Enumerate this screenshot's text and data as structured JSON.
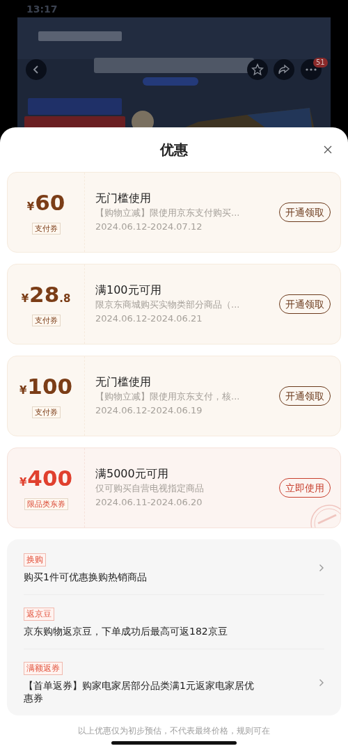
{
  "status_bar": {
    "time": "13:17"
  },
  "backdrop": {
    "kind": "picture",
    "badge": "51"
  },
  "sheet": {
    "title": "优惠"
  },
  "coupons": [
    {
      "kind": "pay",
      "currency": "¥",
      "amount": "60",
      "tag": "支付券",
      "title": "无门槛使用",
      "description": "【购物立减】限使用京东支付购买...",
      "dates": "2024.06.12-2024.07.12",
      "action": "开通领取",
      "claimed": false
    },
    {
      "kind": "pay",
      "currency": "¥",
      "amount": "28",
      "decimal": ".8",
      "tag": "支付券",
      "title": "满100元可用",
      "description": "限京东商城购买实物类部分商品（...",
      "dates": "2024.06.12-2024.06.21",
      "action": "开通领取",
      "claimed": false
    },
    {
      "kind": "pay",
      "currency": "¥",
      "amount": "100",
      "tag": "支付券",
      "title": "无门槛使用",
      "description": "【购物立减】限使用京东支付，核...",
      "dates": "2024.06.12-2024.06.19",
      "action": "开通领取",
      "claimed": false
    },
    {
      "kind": "category",
      "currency": "¥",
      "amount": "400",
      "tag": "限品类东券",
      "title": "满5000元可用",
      "description": "仅可购买自营电视指定商品",
      "dates": "2024.06.11-2024.06.20",
      "action": "立即使用",
      "claimed": true
    }
  ],
  "perks": [
    {
      "tag": "换购",
      "text": "购买1件可优惠换购热销商品",
      "has_link": true
    },
    {
      "tag": "返京豆",
      "text": "京东购物返京豆，下单成功后最高可返182京豆",
      "has_link": false
    },
    {
      "tag": "满额返券",
      "text": "【首单返券】购家电家居部分品类满1元返家电家居优惠券",
      "has_link": true
    }
  ],
  "footer": "以上优惠仅为初步预估，不代表最终价格，规则可在"
}
